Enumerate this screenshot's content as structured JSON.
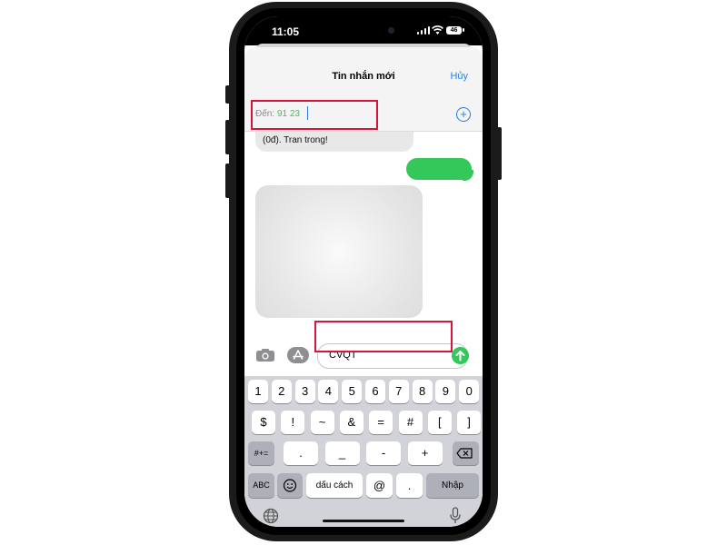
{
  "status_bar": {
    "time": "11:05",
    "battery": "46"
  },
  "nav": {
    "title": "Tin nhắn mới",
    "cancel_label": "Hủy"
  },
  "recipient": {
    "label": "Đến:",
    "value": "91 23"
  },
  "messages": {
    "incoming_text": "(0đ). Tran trong!"
  },
  "composer": {
    "text": "CVQT"
  },
  "keyboard": {
    "row1": [
      "1",
      "2",
      "3",
      "4",
      "5",
      "6",
      "7",
      "8",
      "9",
      "0"
    ],
    "row2": [
      "$",
      "!",
      "~",
      "&",
      "=",
      "#",
      "[",
      "]"
    ],
    "row3": {
      "shift": "#+=",
      "keys": [
        ".",
        "_",
        "-",
        "+"
      ]
    },
    "row4": {
      "abc": "ABC",
      "space": "dấu cách",
      "at": "@",
      "dot": ".",
      "enter": "Nhập"
    }
  },
  "colors": {
    "accent": "#2a7de1",
    "green": "#34c759",
    "highlight": "#d8143c"
  }
}
